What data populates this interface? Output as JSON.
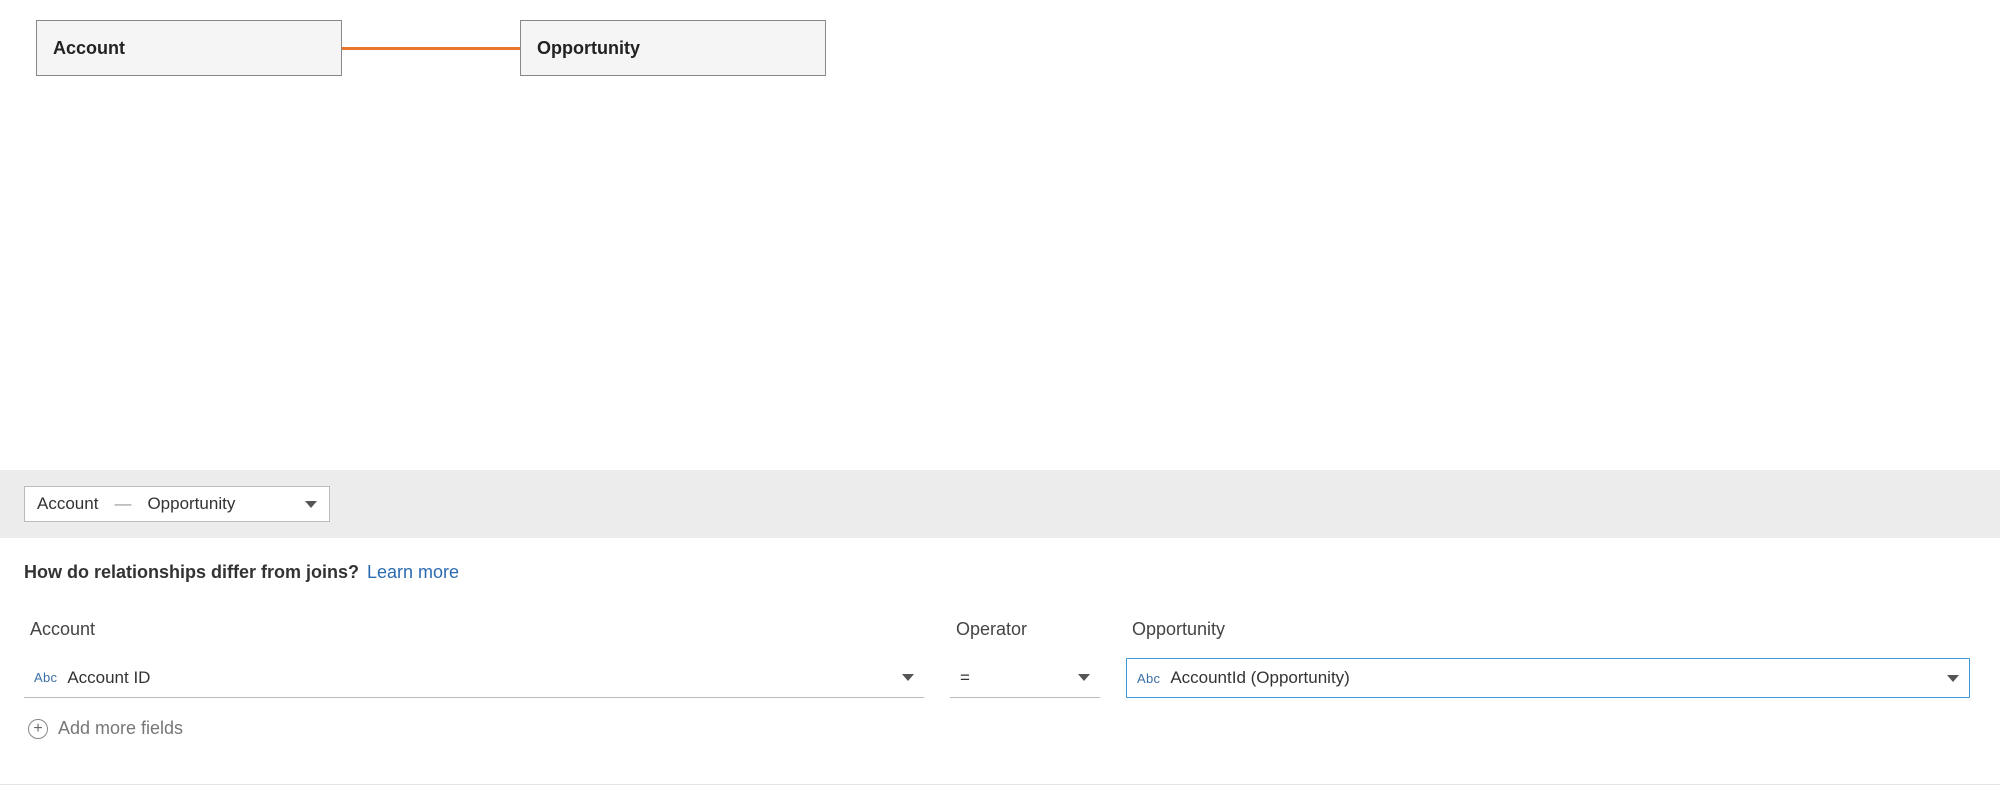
{
  "canvas": {
    "node_left": "Account",
    "node_right": "Opportunity"
  },
  "relationship_selector": {
    "left": "Account",
    "separator": "—",
    "right": "Opportunity"
  },
  "help": {
    "question": "How do relationships differ from joins?",
    "link": "Learn more"
  },
  "columns": {
    "left_header": "Account",
    "operator_header": "Operator",
    "right_header": "Opportunity"
  },
  "row": {
    "left_type_icon": "Abc",
    "left_field": "Account ID",
    "operator": "=",
    "right_type_icon": "Abc",
    "right_field": "AccountId (Opportunity)"
  },
  "add_more": "Add more fields"
}
